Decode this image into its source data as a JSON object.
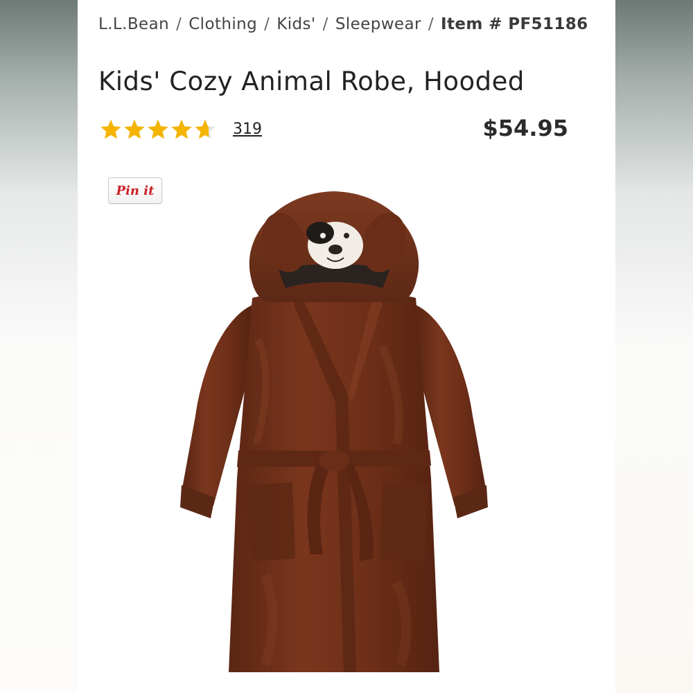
{
  "breadcrumb": {
    "items": [
      "L.L.Bean",
      "Clothing",
      "Kids'",
      "Sleepwear"
    ],
    "separator": "/",
    "item_number": "Item # PF51186"
  },
  "product": {
    "title": "Kids' Cozy Animal Robe, Hooded",
    "rating": 4.7,
    "rating_max": 5,
    "review_count": "319",
    "price": "$54.95"
  },
  "pin_button": {
    "label": "Pin it"
  },
  "colors": {
    "star": "#f4b400",
    "robe": "#6e3019",
    "pin_red": "#cb2027"
  }
}
